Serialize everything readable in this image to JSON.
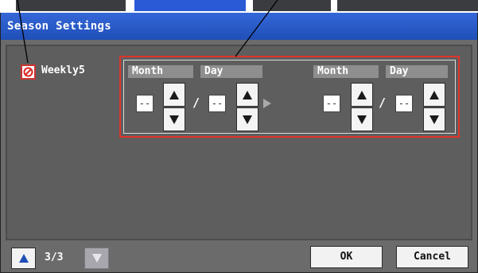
{
  "dialog": {
    "title": "Season Settings"
  },
  "weekly": {
    "label": "Weekly5",
    "enabled": false
  },
  "range": {
    "start": {
      "month_header": "Month",
      "day_header": "Day",
      "month_value": "--",
      "day_value": "--"
    },
    "end": {
      "month_header": "Month",
      "day_header": "Day",
      "month_value": "--",
      "day_value": "--"
    },
    "separator": "/"
  },
  "footer": {
    "page_indicator": "3/3",
    "ok_label": "OK",
    "cancel_label": "Cancel"
  },
  "colors": {
    "titlebar": "#2a5ad6",
    "body": "#6b6b6b",
    "highlight": "#e0342b",
    "arrow": "#1f4fb8"
  }
}
